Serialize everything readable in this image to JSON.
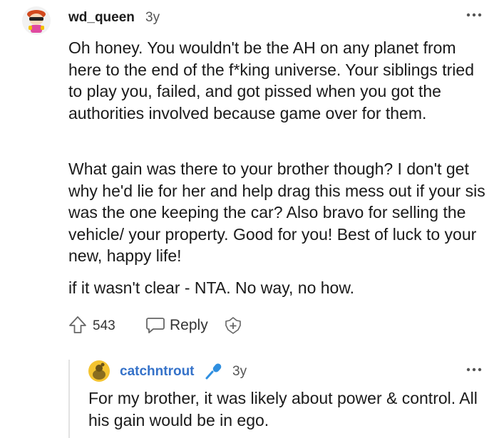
{
  "comment": {
    "username": "wd_queen",
    "age": "3y",
    "paragraphs": [
      "Oh honey. You wouldn't be the AH on any planet from here to the end of the f*king universe. Your siblings tried to play you, failed, and got pissed when you got the authorities involved because game over for them.",
      "What gain was there to your brother though? I don't get why he'd lie for her and help drag this mess out if your sis was the one keeping the car? Also bravo for selling the vehicle/ your property. Good for you! Best of luck to your new, happy life!",
      "if it wasn't clear - NTA. No way, no how."
    ],
    "score": "543",
    "reply_label": "Reply"
  },
  "reply": {
    "username": "catchntrout",
    "age": "3y",
    "text": "For my brother, it was likely about power & control. All his gain would be in ego."
  },
  "icons": {
    "upvote": "upvote-arrow-icon",
    "reply": "speech-bubble-icon",
    "award": "award-plus-icon",
    "more": "more-dots-icon",
    "flair": "microphone-icon"
  },
  "colors": {
    "reply_username": "#3572c9",
    "flair": "#2f8fe0"
  }
}
